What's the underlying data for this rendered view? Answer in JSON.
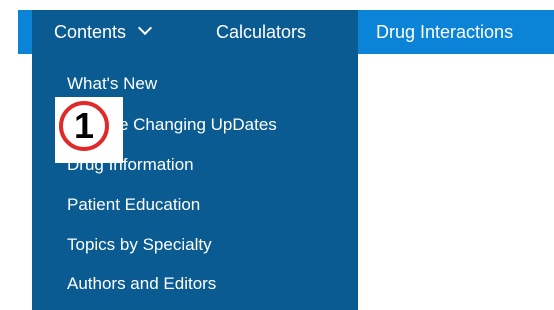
{
  "nav": {
    "items": [
      {
        "label": "Contents"
      },
      {
        "label": "Calculators"
      },
      {
        "label": "Drug Interactions"
      }
    ]
  },
  "dropdown": {
    "items": [
      {
        "label": "What's New"
      },
      {
        "label": "Practice Changing UpDates",
        "visible_label": "ce Changing UpDates"
      },
      {
        "label": "Drug Information"
      },
      {
        "label": "Patient Education"
      },
      {
        "label": "Topics by Specialty"
      },
      {
        "label": "Authors and Editors"
      }
    ]
  },
  "annotation": {
    "number": "1",
    "ring_color": "#e02a2a"
  },
  "colors": {
    "nav_background": "#0b84d8",
    "menu_background": "#0a5b92",
    "text": "#ffffff"
  }
}
